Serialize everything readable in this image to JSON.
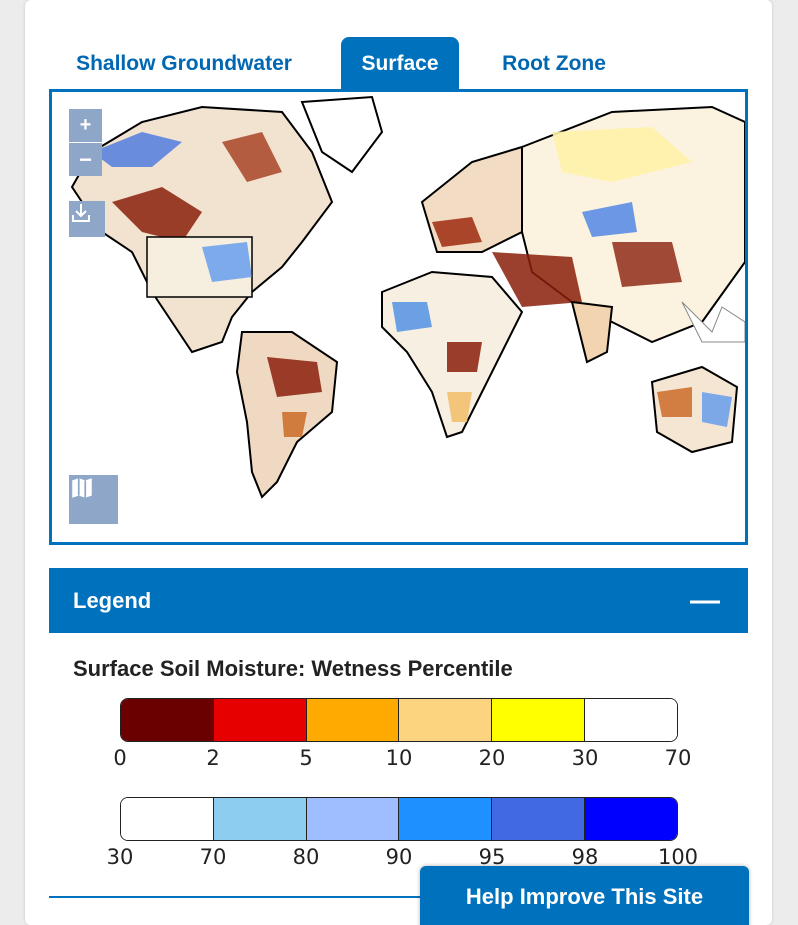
{
  "tabs": [
    {
      "label": "Shallow Groundwater"
    },
    {
      "label": "Surface"
    },
    {
      "label": "Root Zone"
    }
  ],
  "map": {
    "controls": {
      "zoom_in": "+",
      "zoom_out": "−"
    },
    "icons": [
      "download-icon",
      "basemap-icon"
    ]
  },
  "legend": {
    "header": "Legend",
    "collapse_symbol": "—",
    "title": "Surface Soil Moisture: Wetness Percentile",
    "dry_scale": {
      "colors": [
        "#6b0000",
        "#e60000",
        "#ffaa00",
        "#fcd37f",
        "#ffff00",
        "#ffffff"
      ],
      "ticks": [
        "0",
        "2",
        "5",
        "10",
        "20",
        "30",
        "70"
      ]
    },
    "wet_scale": {
      "colors": [
        "#ffffff",
        "#8ccdf0",
        "#9ebeff",
        "#1e90ff",
        "#4169e1",
        "#0000ff"
      ],
      "ticks": [
        "30",
        "70",
        "80",
        "90",
        "95",
        "98",
        "100"
      ]
    }
  },
  "help_button": "Help Improve This Site"
}
